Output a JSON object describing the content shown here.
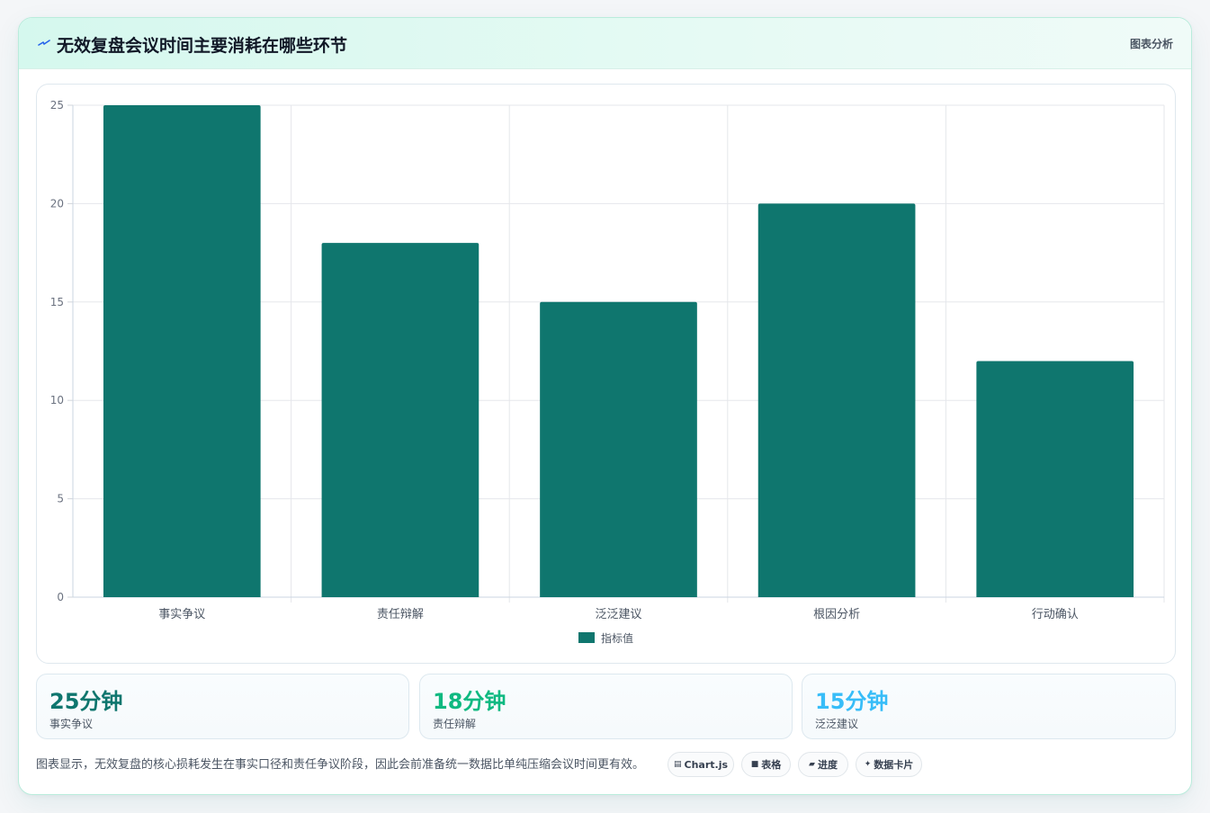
{
  "header": {
    "title": "无效复盘会议时间主要消耗在哪些环节",
    "tag": "图表分析",
    "icon": "lightning-icon"
  },
  "chart_data": {
    "type": "bar",
    "categories": [
      "事实争议",
      "责任辩解",
      "泛泛建议",
      "根因分析",
      "行动确认"
    ],
    "series": [
      {
        "name": "指标值",
        "values": [
          25,
          18,
          15,
          20,
          12
        ],
        "color": "#0f766e"
      }
    ],
    "ylim": [
      0,
      25
    ],
    "yticks": [
      0,
      5,
      10,
      15,
      20,
      25
    ],
    "grid": true,
    "legend": "bottom"
  },
  "stats": [
    {
      "value": "25分钟",
      "label": "事实争议",
      "color": "#0f766e"
    },
    {
      "value": "18分钟",
      "label": "责任辩解",
      "color": "#10b981"
    },
    {
      "value": "15分钟",
      "label": "泛泛建议",
      "color": "#38bdf8"
    }
  ],
  "footer": {
    "text": "图表显示，无效复盘的核心损耗发生在事实口径和责任争议阶段，因此会前准备统一数据比单纯压缩会议时间更有效。",
    "pills": [
      {
        "icon": "chart-icon",
        "glyph": "▤",
        "label": "Chart.js"
      },
      {
        "icon": "table-icon",
        "glyph": "■",
        "label": "表格"
      },
      {
        "icon": "progress-icon",
        "glyph": "▰",
        "label": "进度"
      },
      {
        "icon": "sparkle-icon",
        "glyph": "✦",
        "label": "数据卡片"
      }
    ]
  }
}
